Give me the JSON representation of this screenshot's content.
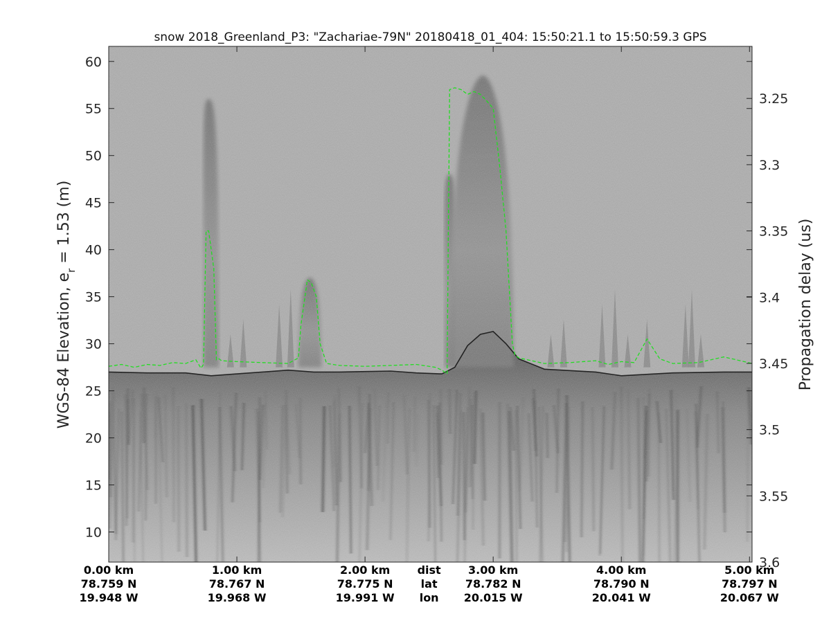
{
  "chart_data": {
    "type": "heatmap",
    "title": "snow 2018_Greenland_P3: \"Zachariae-79N\"  20180418_01_404: 15:50:21.1 to 15:50:59.3 GPS",
    "ylabel_main": "WGS-84 Elevation, e",
    "ylabel_sub": "r",
    "ylabel_rest": " = 1.53 (m)",
    "y2label": "Propagation delay (us)",
    "xlim": [
      0,
      5.02
    ],
    "ylim": [
      6.8,
      61.6
    ],
    "y2lim": [
      3.2107,
      3.6
    ],
    "grid": false,
    "colormap": "gray",
    "yticks": [
      10,
      15,
      20,
      25,
      30,
      35,
      40,
      45,
      50,
      55,
      60
    ],
    "y2ticks": [
      {
        "value": 3.25,
        "label": "3.25"
      },
      {
        "value": 3.3,
        "label": "3.3"
      },
      {
        "value": 3.35,
        "label": "3.35"
      },
      {
        "value": 3.4,
        "label": "3.4"
      },
      {
        "value": 3.45,
        "label": "3.45"
      },
      {
        "value": 3.5,
        "label": "3.5"
      },
      {
        "value": 3.55,
        "label": "3.55"
      },
      {
        "value": 3.6,
        "label": "3.6"
      }
    ],
    "xticks": [
      {
        "x": 0.0,
        "dist": "0.00 km",
        "lat": "78.759 N",
        "lon": "19.948 W"
      },
      {
        "x": 1.0,
        "dist": "1.00 km",
        "lat": "78.767 N",
        "lon": "19.968 W"
      },
      {
        "x": 2.0,
        "dist": "2.00 km",
        "lat": "78.775 N",
        "lon": "19.991 W"
      },
      {
        "x": 3.0,
        "dist": "3.00 km",
        "lat": "78.782 N",
        "lon": "20.015 W"
      },
      {
        "x": 4.0,
        "dist": "4.00 km",
        "lat": "78.790 N",
        "lon": "20.041 W"
      },
      {
        "x": 5.0,
        "dist": "5.00 km",
        "lat": "78.797 N",
        "lon": "20.067 W"
      }
    ],
    "row_labels": {
      "dist": "dist",
      "lat": "lat",
      "lon": "lon"
    },
    "colors": {
      "surface_trace": "#22dd22",
      "bed_line": "#000000",
      "background": "#aaaaaa"
    },
    "series": [
      {
        "kind": "surface-trace",
        "x": [
          0.0,
          0.1,
          0.2,
          0.3,
          0.4,
          0.5,
          0.6,
          0.68,
          0.72,
          0.74,
          0.76,
          0.78,
          0.82,
          0.84,
          0.86,
          0.88,
          1.0,
          1.2,
          1.4,
          1.48,
          1.5,
          1.55,
          1.58,
          1.62,
          1.65,
          1.7,
          1.8,
          2.0,
          2.2,
          2.4,
          2.55,
          2.6,
          2.62,
          2.64,
          2.66,
          2.7,
          2.75,
          2.8,
          2.85,
          2.9,
          2.95,
          3.0,
          3.05,
          3.1,
          3.15,
          3.17,
          3.2,
          3.3,
          3.4,
          3.6,
          3.8,
          3.9,
          4.0,
          4.1,
          4.2,
          4.3,
          4.4,
          4.6,
          4.8,
          5.02
        ],
        "y": [
          27.6,
          27.8,
          27.5,
          27.8,
          27.7,
          28.0,
          27.9,
          28.3,
          27.4,
          27.8,
          42.0,
          42.0,
          38.0,
          28.3,
          28.4,
          28.2,
          28.1,
          28.0,
          27.9,
          28.5,
          32.0,
          36.8,
          36.5,
          35.0,
          30.0,
          27.9,
          27.7,
          27.6,
          27.7,
          27.8,
          27.5,
          27.2,
          27.0,
          26.8,
          57.0,
          57.2,
          57.0,
          56.5,
          56.8,
          56.5,
          55.8,
          55.0,
          49.0,
          42.0,
          30.0,
          28.8,
          28.5,
          28.2,
          27.9,
          28.0,
          28.2,
          27.8,
          28.1,
          28.0,
          30.5,
          28.4,
          27.9,
          28.0,
          28.6,
          27.9
        ]
      },
      {
        "kind": "bed-line",
        "x": [
          0.0,
          0.3,
          0.6,
          0.8,
          1.0,
          1.4,
          1.6,
          1.8,
          2.2,
          2.4,
          2.6,
          2.7,
          2.8,
          2.9,
          3.0,
          3.1,
          3.2,
          3.4,
          3.8,
          4.0,
          4.4,
          4.8,
          5.02
        ],
        "y": [
          27.0,
          26.9,
          26.9,
          26.6,
          26.8,
          27.2,
          27.0,
          27.0,
          27.1,
          26.9,
          26.8,
          27.5,
          29.8,
          31.0,
          31.3,
          30.0,
          28.4,
          27.3,
          27.0,
          26.6,
          26.9,
          27.0,
          27.0
        ]
      }
    ]
  }
}
